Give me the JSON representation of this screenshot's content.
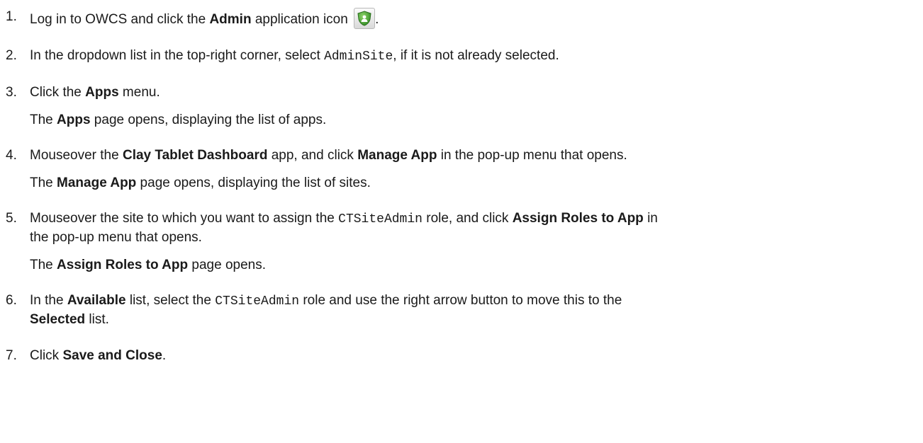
{
  "steps": [
    {
      "number": "1.",
      "text_a": "Log in to OWCS and click the ",
      "bold_a": "Admin",
      "text_b": " application icon ",
      "text_c": ".",
      "icon": "admin-application-icon"
    },
    {
      "number": "2.",
      "text_a": "In the dropdown list in the top-right corner, select ",
      "code_a": "AdminSite",
      "text_b": ", if it is not already selected."
    },
    {
      "number": "3.",
      "text_a": "Click the ",
      "bold_a": "Apps",
      "text_b": " menu.",
      "sub_text_a": "The ",
      "sub_bold_a": "Apps",
      "sub_text_b": " page opens, displaying the list of apps."
    },
    {
      "number": "4.",
      "text_a": "Mouseover the ",
      "bold_a": "Clay Tablet Dashboard",
      "text_b": " app, and click ",
      "bold_b": "Manage App",
      "text_c": " in the pop-up menu that opens.",
      "sub_text_a": "The ",
      "sub_bold_a": "Manage App",
      "sub_text_b": " page opens, displaying the list of sites."
    },
    {
      "number": "5.",
      "text_a": "Mouseover the site to which you want to assign the ",
      "code_a": "CTSiteAdmin",
      "text_b": " role, and click ",
      "bold_a": "Assign Roles to App",
      "text_c": " in",
      "line2": "the pop-up menu that opens.",
      "sub_text_a": "The ",
      "sub_bold_a": "Assign Roles to App",
      "sub_text_b": " page opens."
    },
    {
      "number": "6.",
      "text_a": "In the ",
      "bold_a": "Available",
      "text_b": " list, select the ",
      "code_a": "CTSiteAdmin",
      "text_c": " role and use the right arrow button to move this to the",
      "line2_bold": "Selected",
      "line2_text": " list."
    },
    {
      "number": "7.",
      "text_a": "Click ",
      "bold_a": "Save and Close",
      "text_b": "."
    }
  ],
  "colors": {
    "text": "#1a1a1a",
    "icon_green": "#3f9b2d",
    "icon_frame": "#b8b8b8"
  }
}
